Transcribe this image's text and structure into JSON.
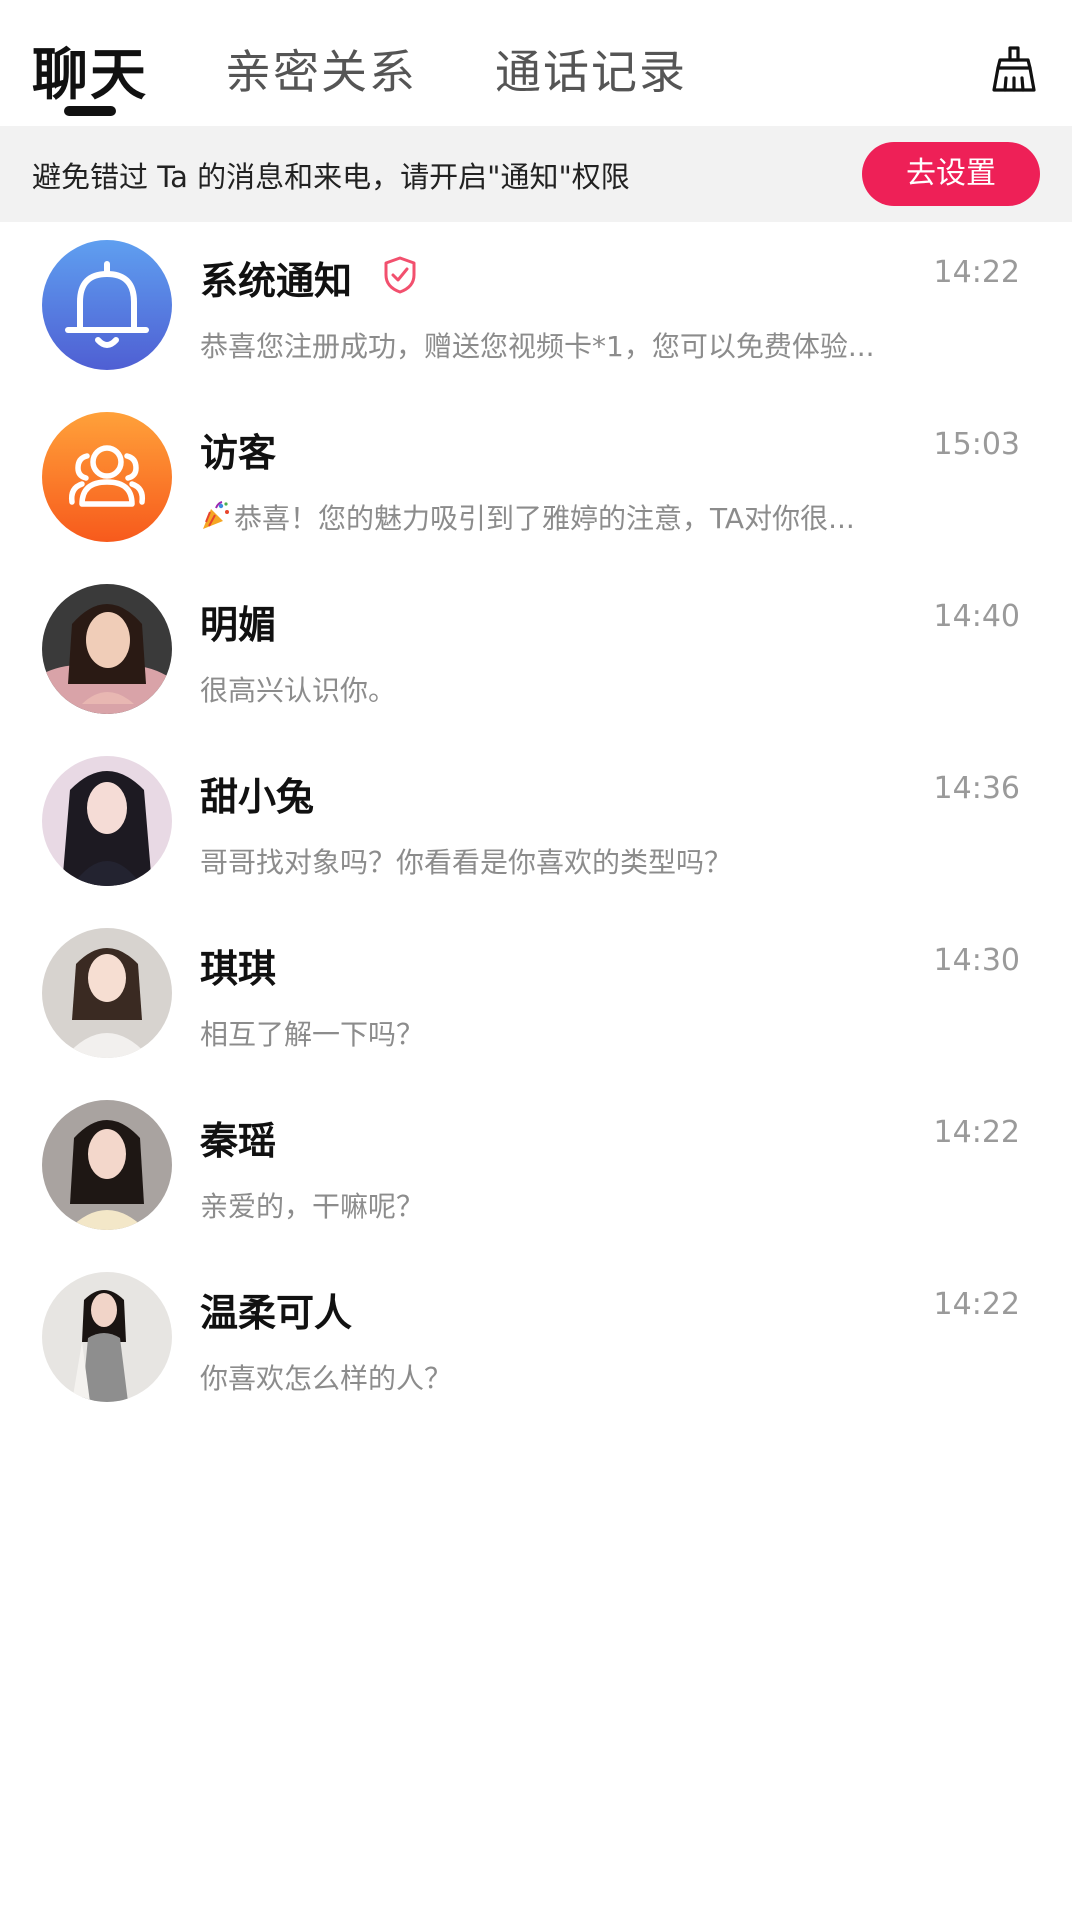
{
  "tabs": [
    {
      "label": "聊天",
      "active": true
    },
    {
      "label": "亲密关系",
      "active": false
    },
    {
      "label": "通话记录",
      "active": false
    }
  ],
  "header": {
    "clear_icon": "broom-icon"
  },
  "notice": {
    "text": "避免错过 Ta 的消息和来电，请开启\"通知\"权限",
    "button": "去设置"
  },
  "colors": {
    "accent": "#ee2057",
    "bell_top": "#5f9ff0",
    "bell_bottom": "#4f5fd3",
    "visitor_top": "#ffa13a",
    "visitor_bottom": "#f75a1c"
  },
  "conversations": [
    {
      "name": "系统通知",
      "time": "14:22",
      "preview": "恭喜您注册成功，赠送您视频卡*1，您可以免费体验...",
      "avatar": "bell-icon",
      "verified": true
    },
    {
      "name": "访客",
      "time": "15:03",
      "preview": "恭喜！您的魅力吸引到了雅婷的注意，TA对你很...",
      "avatar": "visitors-icon",
      "emoji": "party-popper-icon"
    },
    {
      "name": "明媚",
      "time": "14:40",
      "preview": "很高兴认识你。",
      "avatar": "user-photo"
    },
    {
      "name": "甜小兔",
      "time": "14:36",
      "preview": "哥哥找对象吗？你看看是你喜欢的类型吗？",
      "avatar": "user-photo"
    },
    {
      "name": "琪琪",
      "time": "14:30",
      "preview": "相互了解一下吗？",
      "avatar": "user-photo"
    },
    {
      "name": "秦瑶",
      "time": "14:22",
      "preview": "亲爱的，干嘛呢？",
      "avatar": "user-photo"
    },
    {
      "name": "温柔可人",
      "time": "14:22",
      "preview": "你喜欢怎么样的人？",
      "avatar": "user-photo"
    }
  ]
}
